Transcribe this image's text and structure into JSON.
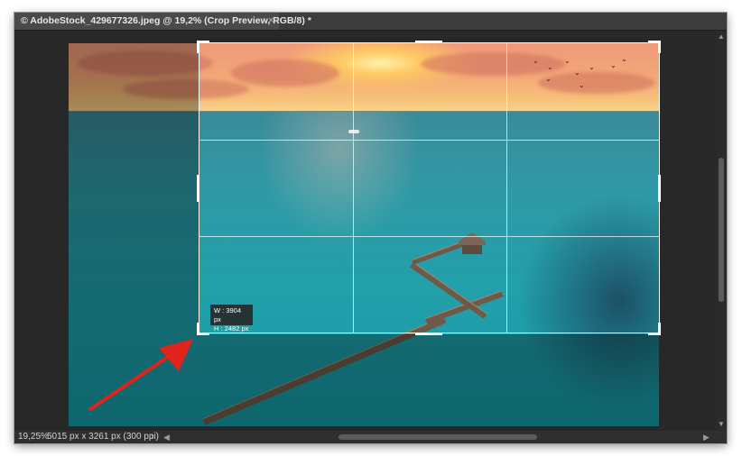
{
  "document_tab": {
    "title": "© AdobeStock_429677326.jpeg @ 19,2% (Crop Preview, RGB/8) *",
    "close_symbol": "×"
  },
  "crop_tooltip": {
    "width_label": "W :",
    "width_value": "3904 px",
    "height_label": "H :",
    "height_value": "2482 px"
  },
  "status_bar": {
    "zoom": "19,25%",
    "doc_info": "5015 px x 3261 px (300 ppi)",
    "arrow": "›"
  },
  "scrollbars": {
    "up": "▲",
    "down": "▼",
    "left": "◀",
    "right": "▶"
  },
  "annotation": {
    "arrow_color": "#e0231b",
    "icon": "red-arrow-icon"
  },
  "colors": {
    "crop_frame": "#ffffff",
    "panel_bg": "#282828"
  }
}
